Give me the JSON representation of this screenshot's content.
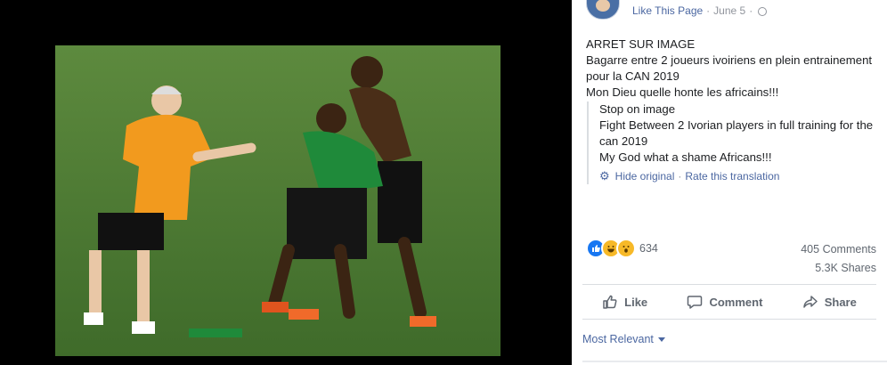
{
  "header": {
    "page_link": "Like This Page",
    "date": "June 5",
    "separator": "·"
  },
  "post": {
    "lines": [
      "ARRET SUR IMAGE",
      "Bagarre entre 2 joueurs ivoiriens en plein entrainement pour la CAN 2019",
      "Mon Dieu quelle honte les africains!!!"
    ]
  },
  "translation": {
    "lines": [
      "Stop on image",
      "Fight Between 2 Ivorian players in full training for the can 2019",
      "My God what a shame Africans!!!"
    ],
    "hide_original": "Hide original",
    "rate": "Rate this translation",
    "separator": "·"
  },
  "reactions": {
    "count": "634",
    "icons": [
      "like-reaction-icon",
      "haha-reaction-icon",
      "wow-reaction-icon"
    ]
  },
  "stats": {
    "comments": "405 Comments",
    "shares": "5.3K Shares"
  },
  "actions": {
    "like": "Like",
    "comment": "Comment",
    "share": "Share"
  },
  "comments_sort": {
    "label": "Most Relevant"
  },
  "colors": {
    "link": "#4b67a1",
    "muted": "#606770",
    "like_blue": "#1877f2",
    "reaction_yellow": "#f7b928"
  }
}
